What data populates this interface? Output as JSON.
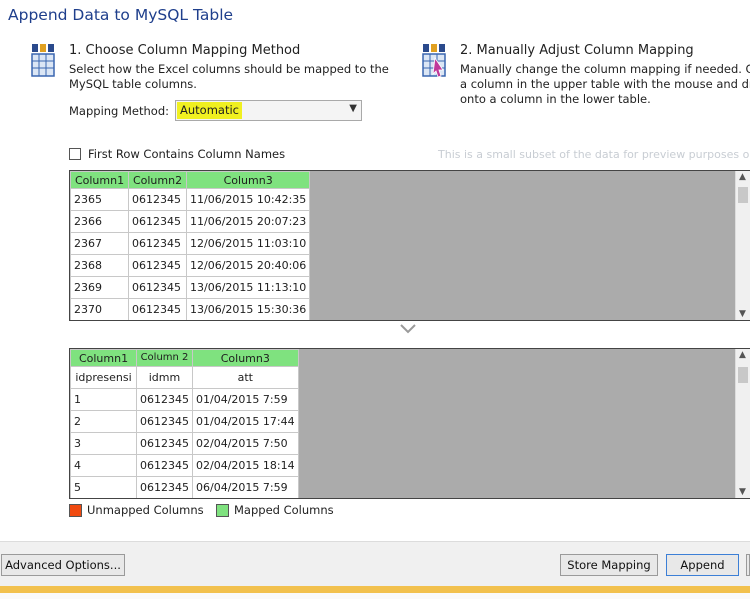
{
  "window": {
    "title": "Append Data to MySQL Table"
  },
  "step1": {
    "heading": "1. Choose Column Mapping Method",
    "desc_line1": "Select how the Excel columns should be mapped to the",
    "desc_line2": "MySQL table columns.",
    "mapping_label": "Mapping Method:",
    "mapping_value": "Automatic"
  },
  "step2": {
    "heading": "2. Manually Adjust Column Mapping",
    "desc_line1": "Manually change the column mapping if needed. Click",
    "desc_line2": "a column in the upper table with the mouse and drag it",
    "desc_line3": "onto a column in the lower table."
  },
  "options": {
    "first_row_label": "First Row Contains Column Names",
    "first_row_checked": false,
    "preview_hint": "This is a small subset of the data for preview purposes only."
  },
  "upper_table": {
    "headers": [
      "Column1",
      "Column2",
      "Column3"
    ],
    "rows": [
      [
        "2365",
        "0612345",
        "11/06/2015 10:42:35"
      ],
      [
        "2366",
        "0612345",
        "11/06/2015 20:07:23"
      ],
      [
        "2367",
        "0612345",
        "12/06/2015 11:03:10"
      ],
      [
        "2368",
        "0612345",
        "12/06/2015 20:40:06"
      ],
      [
        "2369",
        "0612345",
        "13/06/2015 11:13:10"
      ],
      [
        "2370",
        "0612345",
        "13/06/2015 15:30:36"
      ]
    ]
  },
  "lower_table": {
    "headers": [
      "Column1",
      "Column 2",
      "Column3"
    ],
    "field_names": [
      "idpresensi",
      "idmm",
      "att"
    ],
    "rows": [
      [
        "1",
        "0612345",
        "01/04/2015 7:59"
      ],
      [
        "2",
        "0612345",
        "01/04/2015 17:44"
      ],
      [
        "3",
        "0612345",
        "02/04/2015 7:50"
      ],
      [
        "4",
        "0612345",
        "02/04/2015 18:14"
      ],
      [
        "5",
        "0612345",
        "06/04/2015 7:59"
      ]
    ]
  },
  "legend": {
    "unmapped_label": "Unmapped Columns",
    "unmapped_color": "#f04a10",
    "mapped_label": "Mapped Columns",
    "mapped_color": "#7fe27f"
  },
  "buttons": {
    "advanced": "Advanced Options...",
    "store_mapping": "Store Mapping",
    "append": "Append"
  }
}
